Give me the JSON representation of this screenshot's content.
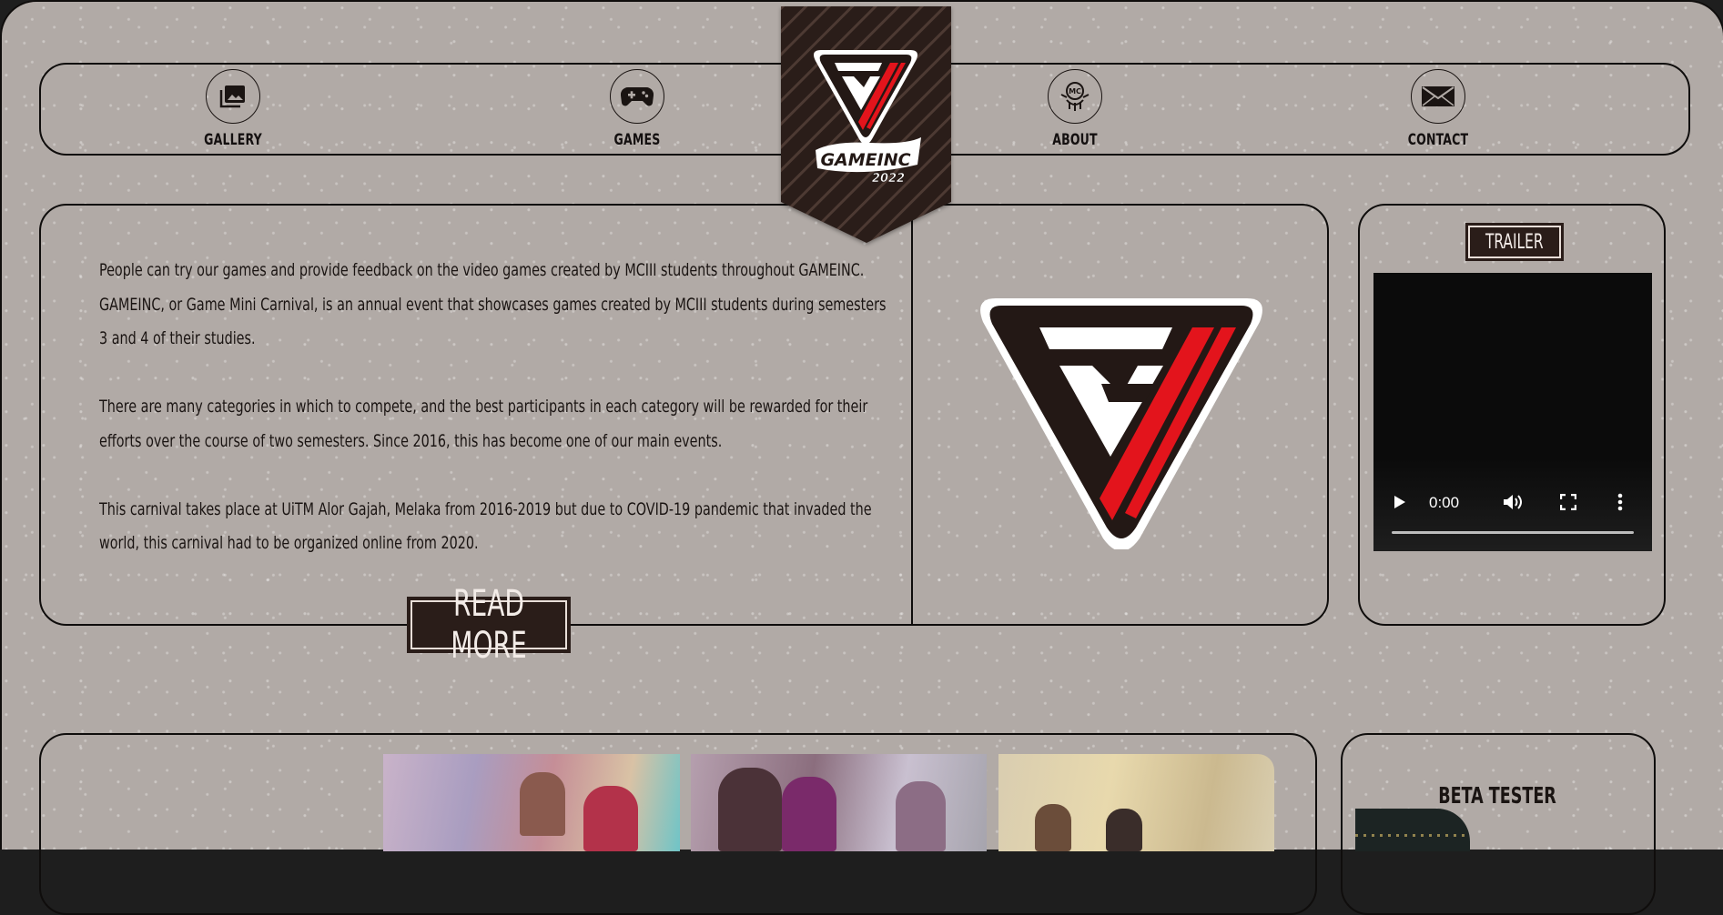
{
  "nav": {
    "items": [
      {
        "label": "GALLERY",
        "icon": "gallery-icon"
      },
      {
        "label": "GAMES",
        "icon": "gamepad-icon"
      },
      {
        "label": "ABOUT",
        "icon": "mc-badge-icon"
      },
      {
        "label": "CONTACT",
        "icon": "envelope-icon"
      }
    ]
  },
  "logo": {
    "line1": "GAMEINC",
    "line2": "2022"
  },
  "intro": {
    "paragraphs": [
      "People can try our games and provide feedback on the video games created by MCIII students throughout GAMEINC. GAMEINC, or Game Mini Carnival, is an annual event that showcases games created by MCIII students during semesters 3 and 4 of their studies.",
      "There are many categories in which to compete, and the best participants in each category will be rewarded for their efforts over the course of two semesters. Since 2016, this has become one of our main events.",
      "This carnival takes place at UiTM Alor Gajah, Melaka from 2016-2019 but due to COVID-19 pandemic that invaded the world, this carnival had to be organized online from 2020."
    ],
    "read_more_label": "READ MORE"
  },
  "trailer": {
    "label": "TRAILER",
    "video_time": "0:00"
  },
  "beta": {
    "title": "BETA TESTER"
  },
  "colors": {
    "background": "#b1aaa6",
    "dark": "#2a1d19",
    "accent_red": "#e3141c",
    "border": "#0f0d0c"
  }
}
